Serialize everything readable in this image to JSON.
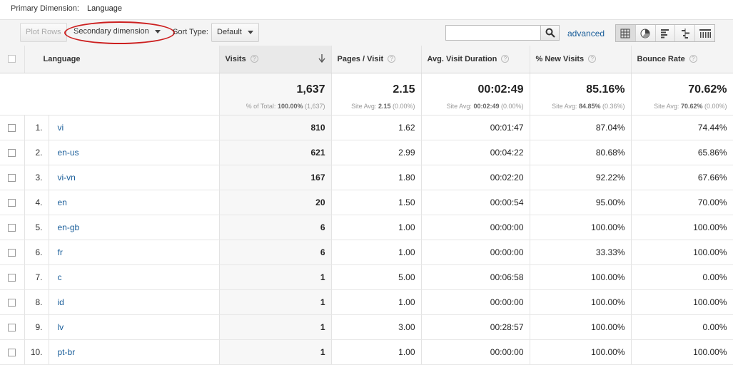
{
  "primary_dimension": {
    "label": "Primary Dimension:",
    "value": "Language"
  },
  "toolbar": {
    "plot_rows": "Plot Rows",
    "secondary_dimension": "Secondary dimension",
    "sort_type_label": "Sort Type:",
    "sort_type_value": "Default",
    "search_placeholder": "",
    "advanced": "advanced",
    "highlight_color": "#cc1f1f"
  },
  "view_icons": [
    "table-view-icon",
    "pie-view-icon",
    "bar-view-icon",
    "comparison-view-icon",
    "pivot-view-icon"
  ],
  "columns": {
    "language": "Language",
    "visits": "Visits",
    "pages_per_visit": "Pages / Visit",
    "avg_duration": "Avg. Visit Duration",
    "new_visits": "% New Visits",
    "bounce_rate": "Bounce Rate",
    "help": "?"
  },
  "summary": {
    "visits": "1,637",
    "visits_sub_label": "% of Total:",
    "visits_sub_value": "100.00%",
    "visits_sub_extra": "(1,637)",
    "pages": "2.15",
    "pages_sub_label": "Site Avg:",
    "pages_sub_value": "2.15",
    "pages_sub_extra": "(0.00%)",
    "duration": "00:02:49",
    "duration_sub_label": "Site Avg:",
    "duration_sub_value": "00:02:49",
    "duration_sub_extra": "(0.00%)",
    "new_visits": "85.16%",
    "new_visits_sub_label": "Site Avg:",
    "new_visits_sub_value": "84.85%",
    "new_visits_sub_extra": "(0.36%)",
    "bounce": "70.62%",
    "bounce_sub_label": "Site Avg:",
    "bounce_sub_value": "70.62%",
    "bounce_sub_extra": "(0.00%)"
  },
  "rows": [
    {
      "idx": "1.",
      "lang": "vi",
      "visits": "810",
      "pages": "1.62",
      "duration": "00:01:47",
      "new": "87.04%",
      "bounce": "74.44%"
    },
    {
      "idx": "2.",
      "lang": "en-us",
      "visits": "621",
      "pages": "2.99",
      "duration": "00:04:22",
      "new": "80.68%",
      "bounce": "65.86%"
    },
    {
      "idx": "3.",
      "lang": "vi-vn",
      "visits": "167",
      "pages": "1.80",
      "duration": "00:02:20",
      "new": "92.22%",
      "bounce": "67.66%"
    },
    {
      "idx": "4.",
      "lang": "en",
      "visits": "20",
      "pages": "1.50",
      "duration": "00:00:54",
      "new": "95.00%",
      "bounce": "70.00%"
    },
    {
      "idx": "5.",
      "lang": "en-gb",
      "visits": "6",
      "pages": "1.00",
      "duration": "00:00:00",
      "new": "100.00%",
      "bounce": "100.00%"
    },
    {
      "idx": "6.",
      "lang": "fr",
      "visits": "6",
      "pages": "1.00",
      "duration": "00:00:00",
      "new": "33.33%",
      "bounce": "100.00%"
    },
    {
      "idx": "7.",
      "lang": "c",
      "visits": "1",
      "pages": "5.00",
      "duration": "00:06:58",
      "new": "100.00%",
      "bounce": "0.00%"
    },
    {
      "idx": "8.",
      "lang": "id",
      "visits": "1",
      "pages": "1.00",
      "duration": "00:00:00",
      "new": "100.00%",
      "bounce": "100.00%"
    },
    {
      "idx": "9.",
      "lang": "lv",
      "visits": "1",
      "pages": "3.00",
      "duration": "00:28:57",
      "new": "100.00%",
      "bounce": "0.00%"
    },
    {
      "idx": "10.",
      "lang": "pt-br",
      "visits": "1",
      "pages": "1.00",
      "duration": "00:00:00",
      "new": "100.00%",
      "bounce": "100.00%"
    }
  ]
}
